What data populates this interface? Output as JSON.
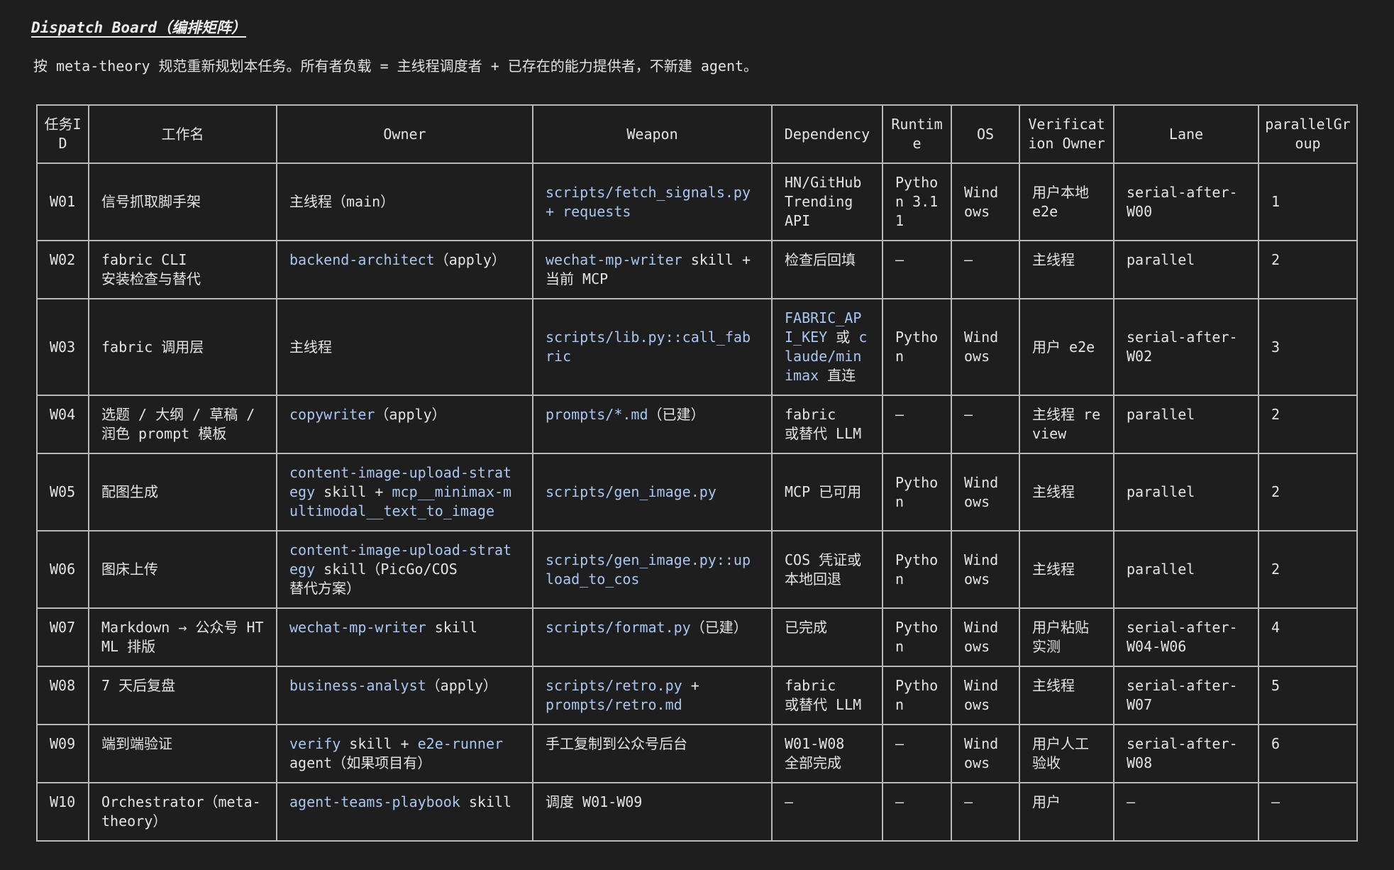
{
  "title": "Dispatch Board（编排矩阵）",
  "intro": "按 meta-theory 规范重新规划本任务。所有者负载 = 主线程调度者 + 已存在的能力提供者，不新建 agent。",
  "colors": {
    "background": "#1e1e1e",
    "text": "#e2e2e2",
    "code": "#a9c6f0",
    "border": "#b8b8b8"
  },
  "columns": [
    "任务ID",
    "工作名",
    "Owner",
    "Weapon",
    "Dependency",
    "Runtime",
    "OS",
    "Verification Owner",
    "Lane",
    "parallelGroup"
  ],
  "rows": [
    {
      "id": "W01",
      "name": "信号抓取脚手架",
      "owner": [
        {
          "t": "主线程（main）",
          "c": false
        }
      ],
      "weapon": [
        {
          "t": "scripts/fetch_signals.py + requests",
          "c": true
        }
      ],
      "dependency": [
        {
          "t": "HN/GitHub Trending API",
          "c": false
        }
      ],
      "runtime": "Python 3.11",
      "os": "Windows",
      "verification": "用户本地 e2e",
      "lane": "serial-after-W00",
      "group": "1",
      "valign": "mid"
    },
    {
      "id": "W02",
      "name": "fabric CLI\n安装检查与替代",
      "owner": [
        {
          "t": "backend-architect",
          "c": true
        },
        {
          "t": "（apply）",
          "c": false
        }
      ],
      "weapon": [
        {
          "t": "wechat-mp-writer",
          "c": true
        },
        {
          "t": " skill + 当前 MCP",
          "c": false
        }
      ],
      "dependency": [
        {
          "t": "检查后回填",
          "c": false
        }
      ],
      "runtime": "–",
      "os": "–",
      "verification": "主线程",
      "lane": "parallel",
      "group": "2",
      "valign": "top"
    },
    {
      "id": "W03",
      "name": "fabric 调用层",
      "owner": [
        {
          "t": "主线程",
          "c": false
        }
      ],
      "weapon": [
        {
          "t": "scripts/lib.py::call_fabric",
          "c": true
        }
      ],
      "dependency": [
        {
          "t": "FABRIC_API_KEY",
          "c": true
        },
        {
          "t": " 或 ",
          "c": false
        },
        {
          "t": "claude/minimax",
          "c": true
        },
        {
          "t": " 直连",
          "c": false
        }
      ],
      "runtime": "Python",
      "os": "Windows",
      "verification": "用户 e2e",
      "lane": "serial-after-W02",
      "group": "3",
      "valign": "mid"
    },
    {
      "id": "W04",
      "name": "选题 / 大纲 / 草稿 / 润色 prompt 模板",
      "owner": [
        {
          "t": "copywriter",
          "c": true
        },
        {
          "t": "（apply）",
          "c": false
        }
      ],
      "weapon": [
        {
          "t": "prompts/*.md",
          "c": true
        },
        {
          "t": "（已建）",
          "c": false
        }
      ],
      "dependency": [
        {
          "t": "fabric\n或替代 LLM",
          "c": false
        }
      ],
      "runtime": "–",
      "os": "–",
      "verification": "主线程 review",
      "lane": "parallel",
      "group": "2",
      "valign": "top"
    },
    {
      "id": "W05",
      "name": "配图生成",
      "owner": [
        {
          "t": "content-image-upload-strategy",
          "c": true
        },
        {
          "t": " skill + ",
          "c": false
        },
        {
          "t": "mcp__minimax-multimodal__text_to_image",
          "c": true
        }
      ],
      "weapon": [
        {
          "t": "scripts/gen_image.py",
          "c": true
        }
      ],
      "dependency": [
        {
          "t": "MCP 已可用",
          "c": false
        }
      ],
      "runtime": "Python",
      "os": "Windows",
      "verification": "主线程",
      "lane": "parallel",
      "group": "2",
      "valign": "mid"
    },
    {
      "id": "W06",
      "name": "图床上传",
      "owner": [
        {
          "t": "content-image-upload-strategy",
          "c": true
        },
        {
          "t": " skill（PicGo/COS\n替代方案）",
          "c": false
        }
      ],
      "weapon": [
        {
          "t": "scripts/gen_image.py::upload_to_cos",
          "c": true
        }
      ],
      "dependency": [
        {
          "t": "COS 凭证或本地回退",
          "c": false
        }
      ],
      "runtime": "Python",
      "os": "Windows",
      "verification": "主线程",
      "lane": "parallel",
      "group": "2",
      "valign": "mid"
    },
    {
      "id": "W07",
      "name": "Markdown → 公众号 HTML 排版",
      "owner": [
        {
          "t": "wechat-mp-writer",
          "c": true
        },
        {
          "t": " skill",
          "c": false
        }
      ],
      "weapon": [
        {
          "t": "scripts/format.py",
          "c": true
        },
        {
          "t": "（已建）",
          "c": false
        }
      ],
      "dependency": [
        {
          "t": "已完成",
          "c": false
        }
      ],
      "runtime": "Python",
      "os": "Windows",
      "verification": "用户粘贴实测",
      "lane": "serial-after-W04-W06",
      "group": "4",
      "valign": "top"
    },
    {
      "id": "W08",
      "name": "7 天后复盘",
      "owner": [
        {
          "t": "business-analyst",
          "c": true
        },
        {
          "t": "（apply）",
          "c": false
        }
      ],
      "weapon": [
        {
          "t": "scripts/retro.py",
          "c": true
        },
        {
          "t": " +\n",
          "c": false
        },
        {
          "t": "prompts/retro.md",
          "c": true
        }
      ],
      "dependency": [
        {
          "t": "fabric\n或替代 LLM",
          "c": false
        }
      ],
      "runtime": "Python",
      "os": "Windows",
      "verification": "主线程",
      "lane": "serial-after-W07",
      "group": "5",
      "valign": "top"
    },
    {
      "id": "W09",
      "name": "端到端验证",
      "owner": [
        {
          "t": "verify",
          "c": true
        },
        {
          "t": " skill + ",
          "c": false
        },
        {
          "t": "e2e-runner",
          "c": true
        },
        {
          "t": "\nagent（如果项目有）",
          "c": false
        }
      ],
      "weapon": [
        {
          "t": "手工复制到公众号后台",
          "c": false
        }
      ],
      "dependency": [
        {
          "t": "W01-W08\n全部完成",
          "c": false
        }
      ],
      "runtime": "–",
      "os": "Windows",
      "verification": "用户人工验收",
      "lane": "serial-after-W08",
      "group": "6",
      "valign": "top"
    },
    {
      "id": "W10",
      "name": "Orchestrator（meta-theory）",
      "owner": [
        {
          "t": "agent-teams-playbook",
          "c": true
        },
        {
          "t": " skill",
          "c": false
        }
      ],
      "weapon": [
        {
          "t": "调度 W01-W09",
          "c": false
        }
      ],
      "dependency": [
        {
          "t": "–",
          "c": false
        }
      ],
      "runtime": "–",
      "os": "–",
      "verification": "用户",
      "lane": "–",
      "group": "–",
      "valign": "top"
    }
  ]
}
